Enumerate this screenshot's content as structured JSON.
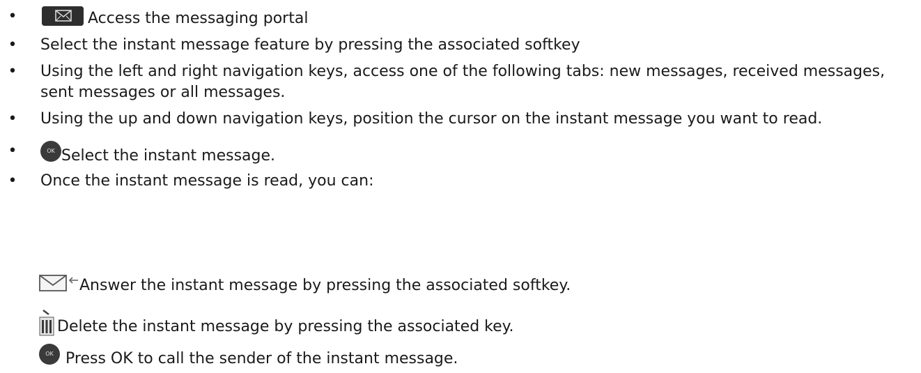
{
  "steps": [
    {
      "text": "Access the messaging portal",
      "icon": "envelope-key-icon"
    },
    {
      "text": "Select the instant message feature by pressing the associated softkey"
    },
    {
      "text": "Using the left and right navigation keys, access one of the following tabs: new messages, received messages, sent messages or all messages."
    },
    {
      "text": "Using the up and down navigation keys, position the cursor on the instant message you want to read."
    },
    {
      "text": "Select the instant message.",
      "icon": "ok-button-icon"
    },
    {
      "text": "Once the instant message is read, you can:"
    }
  ],
  "options": [
    {
      "text": "Answer the instant message by pressing the associated softkey.",
      "icon": "reply-envelope-icon"
    },
    {
      "text": "Delete the instant message by pressing the associated key.",
      "icon": "trash-icon"
    },
    {
      "text": "Press OK to call the sender of the instant message.",
      "icon": "ok-button-icon"
    }
  ],
  "icons": {
    "ok_label": "OK"
  },
  "colors": {
    "text": "#1a1a1a",
    "key_dark": "#2e2e2e",
    "ok_button": "#3a3a3a"
  }
}
